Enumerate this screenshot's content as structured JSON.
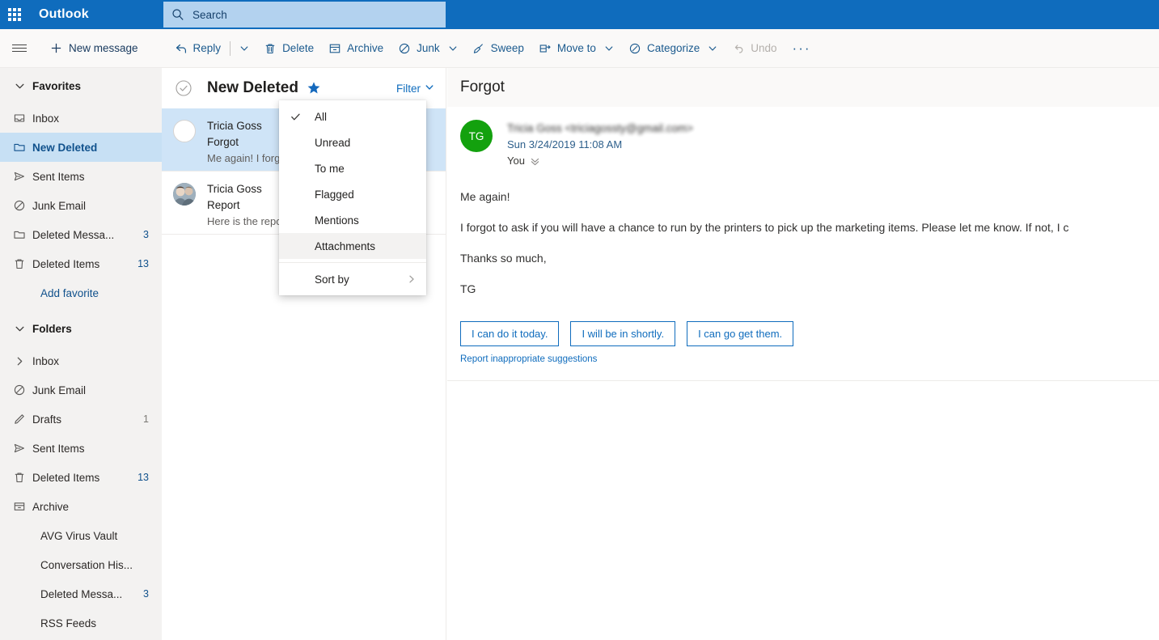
{
  "topbar": {
    "waffle_label": "app-launcher",
    "brand": "Outlook",
    "search": {
      "placeholder": "Search",
      "value": "",
      "icon": "search-icon"
    }
  },
  "commandbar": {
    "hamburger_label": "menu",
    "new_message": "New message",
    "items": [
      {
        "label": "Reply",
        "icon": "reply-icon",
        "split": true,
        "disabled": false
      },
      {
        "label": "Delete",
        "icon": "trash-icon",
        "disabled": false
      },
      {
        "label": "Archive",
        "icon": "archive-icon",
        "disabled": false
      },
      {
        "label": "Junk",
        "icon": "block-icon",
        "chevron": true,
        "disabled": false
      },
      {
        "label": "Sweep",
        "icon": "broom-icon",
        "disabled": false
      },
      {
        "label": "Move to",
        "icon": "move-icon",
        "chevron": true,
        "disabled": false
      },
      {
        "label": "Categorize",
        "icon": "tag-icon",
        "chevron": true,
        "disabled": false
      },
      {
        "label": "Undo",
        "icon": "undo-icon",
        "disabled": true
      }
    ],
    "overflow": "···"
  },
  "sidebar": {
    "favorites": {
      "label": "Favorites",
      "expanded": true,
      "items": [
        {
          "label": "Inbox",
          "icon": "inbox-icon",
          "count": "",
          "selected": false
        },
        {
          "label": "New Deleted",
          "icon": "folder-icon",
          "count": "",
          "selected": true
        },
        {
          "label": "Sent Items",
          "icon": "send-icon",
          "count": "",
          "selected": false
        },
        {
          "label": "Junk Email",
          "icon": "block-icon",
          "count": "",
          "selected": false
        },
        {
          "label": "Deleted Messa...",
          "icon": "folder-icon",
          "count": "3",
          "selected": false
        },
        {
          "label": "Deleted Items",
          "icon": "trash-icon",
          "count": "13",
          "selected": false
        }
      ],
      "add_favorite": "Add favorite"
    },
    "folders": {
      "label": "Folders",
      "expanded": true,
      "items": [
        {
          "label": "Inbox",
          "icon": "chevron-right-icon",
          "count": "",
          "selected": false
        },
        {
          "label": "Junk Email",
          "icon": "block-icon",
          "count": "",
          "selected": false
        },
        {
          "label": "Drafts",
          "icon": "pencil-icon",
          "count": "1",
          "count_muted": true,
          "selected": false
        },
        {
          "label": "Sent Items",
          "icon": "send-icon",
          "count": "",
          "selected": false
        },
        {
          "label": "Deleted Items",
          "icon": "trash-icon",
          "count": "13",
          "selected": false
        },
        {
          "label": "Archive",
          "icon": "archive-icon",
          "count": "",
          "selected": false
        },
        {
          "label": "AVG Virus Vault",
          "icon": "",
          "count": "",
          "selected": false
        },
        {
          "label": "Conversation His...",
          "icon": "",
          "count": "",
          "selected": false
        },
        {
          "label": "Deleted Messa...",
          "icon": "",
          "count": "3",
          "selected": false
        },
        {
          "label": "RSS Feeds",
          "icon": "",
          "count": "",
          "selected": false
        }
      ]
    }
  },
  "message_list": {
    "select_all_icon": "check-circle-icon",
    "title": "New Deleted",
    "pinned_icon": "star-icon",
    "filter_label": "Filter",
    "filter_chevron": "chevron-down-icon",
    "messages": [
      {
        "sender": "Tricia Goss",
        "subject": "Forgot",
        "preview": "Me again! I forgot to ask if you will",
        "avatar_type": "unread-circle",
        "avatar_initials": "",
        "selected": true
      },
      {
        "sender": "Tricia Goss",
        "subject": "Report",
        "preview": "Here is the report you asked for",
        "avatar_type": "photo",
        "avatar_initials": "",
        "selected": false
      }
    ]
  },
  "filter_menu": {
    "open": true,
    "items": [
      {
        "label": "All",
        "checked": true,
        "hovered": false,
        "submenu": false
      },
      {
        "label": "Unread",
        "checked": false,
        "hovered": false,
        "submenu": false
      },
      {
        "label": "To me",
        "checked": false,
        "hovered": false,
        "submenu": false
      },
      {
        "label": "Flagged",
        "checked": false,
        "hovered": false,
        "submenu": false
      },
      {
        "label": "Mentions",
        "checked": false,
        "hovered": false,
        "submenu": false
      },
      {
        "label": "Attachments",
        "checked": false,
        "hovered": true,
        "submenu": false
      },
      {
        "label": "Sort by",
        "checked": false,
        "hovered": false,
        "submenu": true
      }
    ]
  },
  "reading_pane": {
    "title": "Forgot",
    "avatar_initials": "TG",
    "avatar_color": "#13a10e",
    "sender_line": "Tricia Goss <triciagossty@gmail.com>",
    "date": "Sun 3/24/2019 11:08 AM",
    "to": "You",
    "to_chevron": "chevron-double-down-icon",
    "body_paragraphs": [
      "Me again!",
      "I forgot to ask if you will have a chance to run by the printers to pick up the marketing items. Please let me know. If not, I c",
      "Thanks so much,",
      "TG"
    ],
    "suggestions": [
      "I can do it today.",
      "I will be in shortly.",
      "I can go get them."
    ],
    "report_link": "Report inappropriate suggestions"
  },
  "colors": {
    "brand_blue": "#0f6cbd",
    "search_bg": "#b3d2ef",
    "sidebar_bg": "#f3f2f1",
    "selected_nav": "#c7e0f4",
    "selected_row": "#cfe4f7",
    "command_text": "#1b5a8e",
    "avatar_green": "#13a10e",
    "link_blue": "#0f6cbd"
  }
}
